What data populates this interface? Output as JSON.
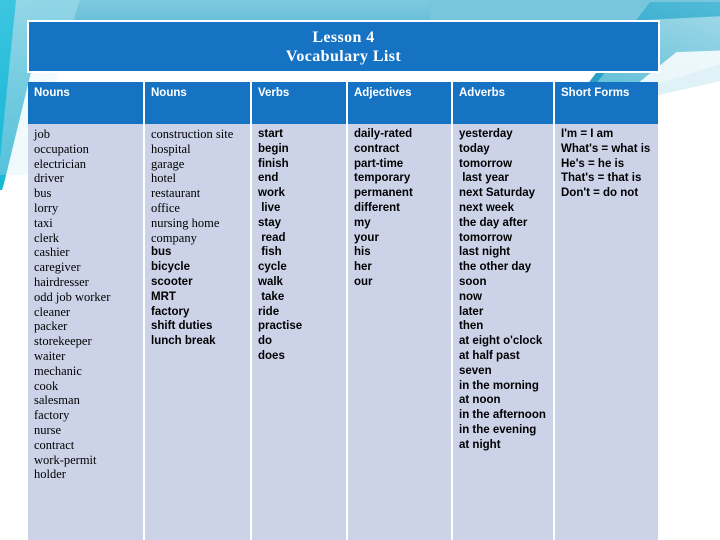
{
  "slide": {
    "title_lines": [
      "Lesson 4",
      "Vocabulary List"
    ],
    "accent_blue": "#1673c4",
    "cell_background": "#ccd3e8",
    "decor_cyan": "#4cc0da"
  },
  "table": {
    "headers": [
      "Nouns",
      "Nouns",
      "Verbs",
      "Adjectives",
      "Adverbs",
      "Short Forms"
    ],
    "columns": [
      {
        "header": "Nouns",
        "style": "serif",
        "items": [
          "job",
          "occupation",
          "electrician",
          "driver",
          "bus",
          "lorry",
          "taxi",
          "clerk",
          "cashier",
          "caregiver",
          "hairdresser",
          "odd job worker",
          "cleaner",
          "packer",
          "storekeeper",
          "waiter",
          "mechanic",
          "cook",
          "salesman",
          "factory",
          "nurse",
          "contract",
          "work-permit",
          "holder"
        ]
      },
      {
        "header": "Nouns",
        "style": "mixed",
        "items": [
          {
            "text": "construction site",
            "face": "serif"
          },
          {
            "text": "hospital",
            "face": "serif"
          },
          {
            "text": "garage",
            "face": "serif"
          },
          {
            "text": "hotel",
            "face": "serif"
          },
          {
            "text": "restaurant",
            "face": "serif"
          },
          {
            "text": "office",
            "face": "serif"
          },
          {
            "text": "nursing home",
            "face": "serif"
          },
          {
            "text": "company",
            "face": "serif"
          },
          {
            "text": "bus",
            "face": "bold"
          },
          {
            "text": "bicycle",
            "face": "bold"
          },
          {
            "text": "scooter",
            "face": "bold"
          },
          {
            "text": "MRT",
            "face": "bold"
          },
          {
            "text": "factory",
            "face": "bold"
          },
          {
            "text": "shift duties",
            "face": "bold"
          },
          {
            "text": "lunch break",
            "face": "bold"
          }
        ]
      },
      {
        "header": "Verbs",
        "style": "bold",
        "items": [
          "start",
          "begin",
          "finish",
          "end",
          "work",
          " live",
          "stay",
          " read",
          " fish",
          "cycle",
          "walk",
          " take",
          "ride",
          "practise",
          "do",
          "does"
        ]
      },
      {
        "header": "Adjectives",
        "style": "bold",
        "items": [
          "daily-rated",
          "contract",
          "part-time",
          "temporary",
          "permanent",
          "different",
          "my",
          "your",
          "his",
          "her",
          "our"
        ]
      },
      {
        "header": "Adverbs",
        "style": "bold",
        "items": [
          "yesterday",
          "today",
          "tomorrow",
          " last year",
          "next Saturday",
          "next week",
          "the day after",
          "tomorrow",
          "last night",
          "the other day",
          "soon",
          "now",
          "later",
          "then",
          "at eight o'clock",
          "at half past",
          "seven",
          "in the morning",
          "at noon",
          "in the afternoon",
          "in the evening",
          "at night"
        ]
      },
      {
        "header": "Short Forms",
        "style": "bold",
        "items": [
          "I'm = I am",
          "What's = what is",
          "He's = he is",
          "That's = that is",
          "Don't = do not"
        ]
      }
    ]
  }
}
